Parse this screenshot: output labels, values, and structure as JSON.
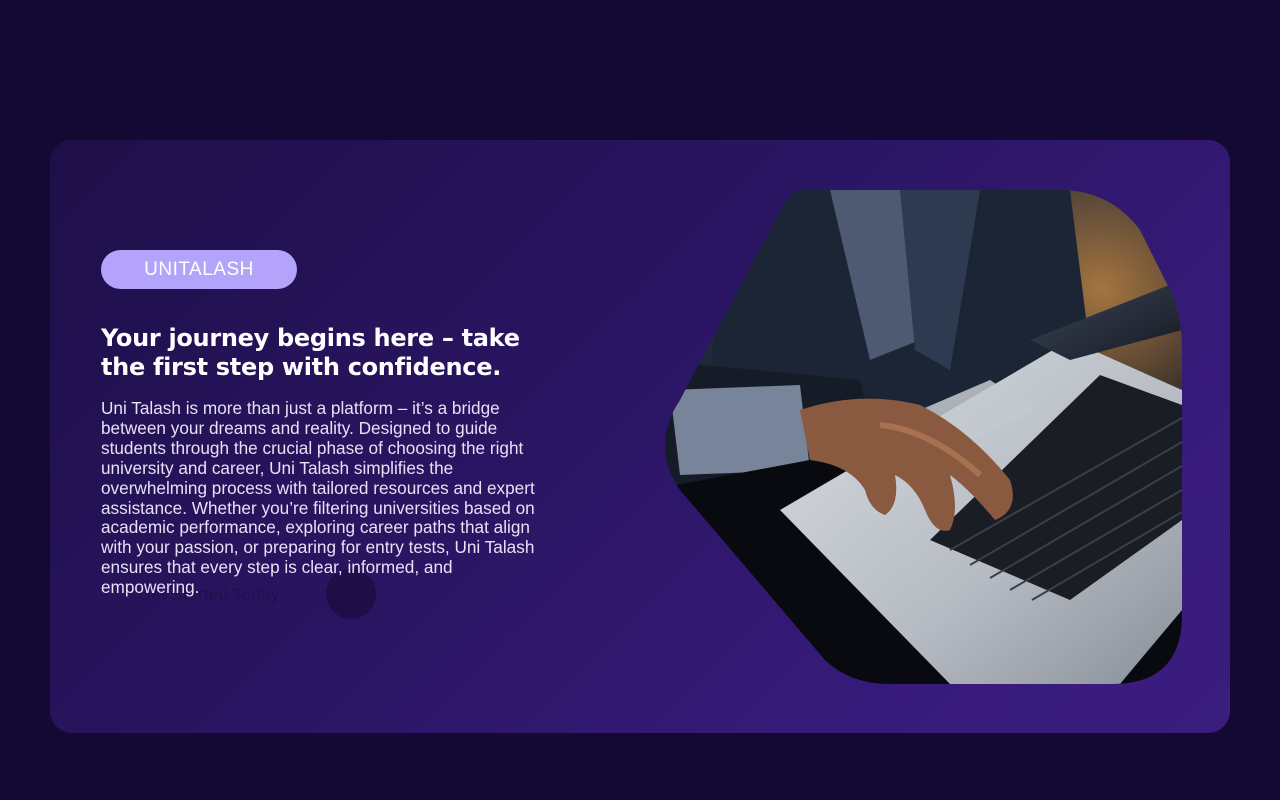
{
  "hero": {
    "brand_label": "UNITALASH",
    "headline": "Your journey begins here – take the first step with confidence.",
    "description": "Uni Talash is more than just a platform – it’s a bridge between your dreams and reality. Designed to guide students through the crucial phase of choosing the right university and career, Uni Talash simplifies the overwhelming process with tailored resources and expert assistance. Whether you’re filtering universities based on academic performance, exploring career paths that align with your passion, or preparing for entry tests, Uni Talash ensures that every step is clear, informed, and empowering.",
    "ghost_label": "Get Started Today",
    "image_icon": "laptop-typing-photo"
  },
  "colors": {
    "page_background": "#140933",
    "card_gradient_start": "#1e0f48",
    "card_gradient_end": "#3b1d80",
    "brand_pill": "#b3a3fb",
    "text_primary": "#ffffff"
  }
}
